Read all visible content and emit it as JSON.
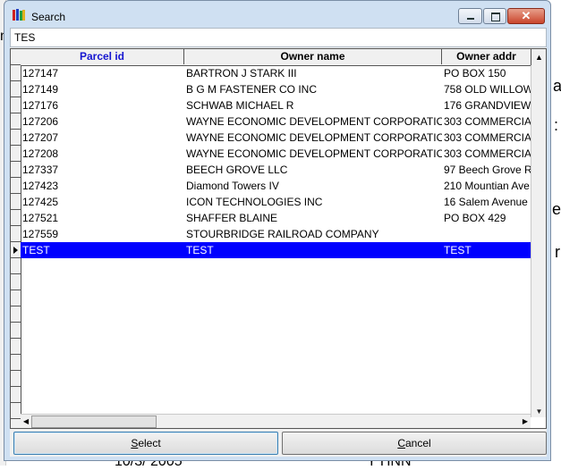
{
  "window": {
    "title": "Search"
  },
  "search": {
    "value": "TES"
  },
  "grid": {
    "columns": [
      "Parcel id",
      "Owner name",
      "Owner addr"
    ],
    "rows": [
      [
        "127147",
        "BARTRON J STARK III",
        "PO BOX 150"
      ],
      [
        "127149",
        "B G M FASTENER CO INC",
        "758 OLD WILLOW"
      ],
      [
        "127176",
        "SCHWAB MICHAEL R",
        "176 GRANDVIEW"
      ],
      [
        "127206",
        "WAYNE ECONOMIC DEVELOPMENT CORPORATIOI",
        "303 COMMERCIA"
      ],
      [
        "127207",
        "WAYNE ECONOMIC DEVELOPMENT CORPORATIOI",
        "303 COMMERCIA"
      ],
      [
        "127208",
        "WAYNE ECONOMIC DEVELOPMENT CORPORATIOI",
        "303 COMMERCIA"
      ],
      [
        "127337",
        "BEECH GROVE LLC",
        "97 Beech Grove R"
      ],
      [
        "127423",
        "Diamond Towers IV",
        "210 Mountian Ave"
      ],
      [
        "127425",
        "ICON TECHNOLOGIES INC",
        "16 Salem Avenue"
      ],
      [
        "127521",
        "SHAFFER BLAINE",
        "PO BOX 429"
      ],
      [
        "127559",
        "STOURBRIDGE RAILROAD COMPANY",
        ""
      ],
      [
        "TEST",
        "TEST",
        "TEST"
      ]
    ],
    "selected_row": 11
  },
  "buttons": {
    "select": {
      "mnemonic": "S",
      "rest": "elect"
    },
    "cancel": {
      "mnemonic": "C",
      "rest": "ancel"
    }
  },
  "background": {
    "frag1": "n",
    "frag2": "as",
    "frag3": ":",
    "frag4": "e",
    "frag5": "r",
    "frag6": "10/3/ 2005",
    "frag7": "Y HNN"
  },
  "colors": {
    "selection": "#0000ff",
    "sorted_header": "#1515d0"
  }
}
